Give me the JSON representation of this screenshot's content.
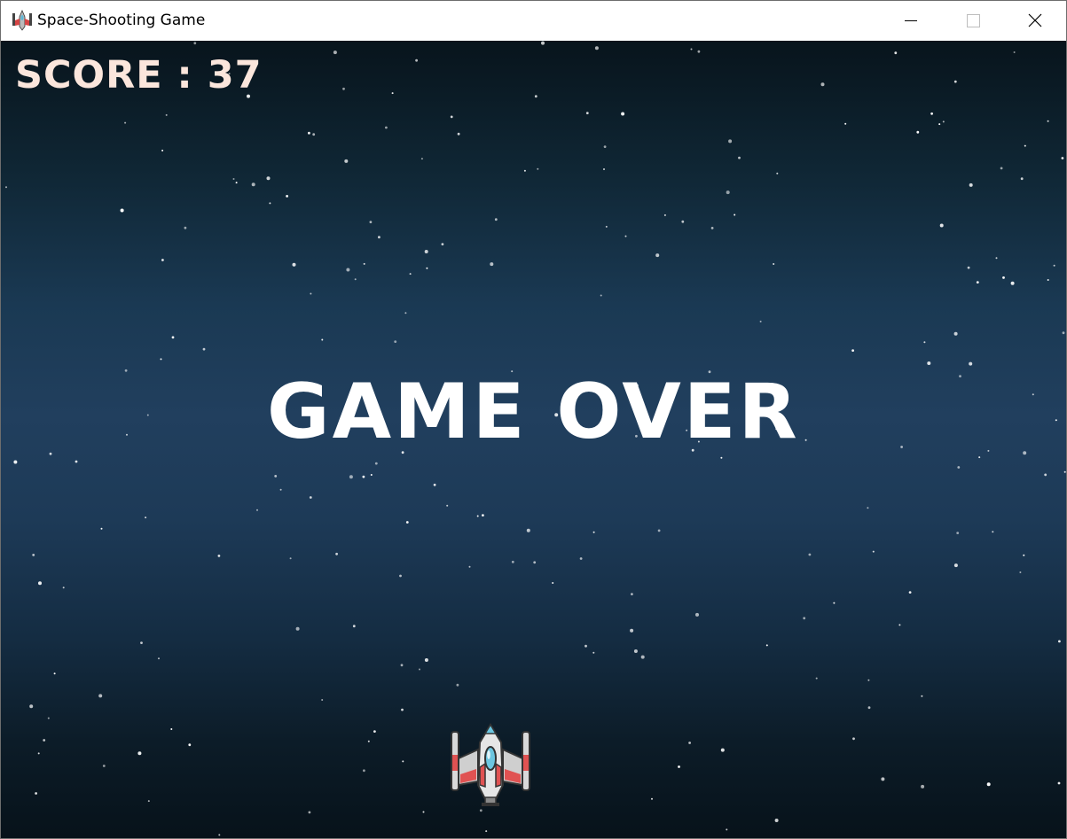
{
  "window": {
    "title": "Space-Shooting Game",
    "app_icon": "spaceship-icon",
    "controls": [
      "minimize-icon",
      "maximize-icon",
      "close-icon"
    ]
  },
  "hud": {
    "score_label": "SCORE",
    "score_separator": ":",
    "score_value": "37",
    "score_text": "SCORE : 37"
  },
  "overlay": {
    "message": "GAME OVER"
  },
  "player": {
    "sprite": "player-spaceship-icon"
  },
  "colors": {
    "score_text": "#fbe6dc",
    "game_over_text": "#ffffff",
    "space_dark": "#08141c",
    "space_mid": "#213f5e",
    "star": "#ffffff",
    "ship_body": "#d8d8d8",
    "ship_accent": "#e05252",
    "ship_cockpit": "#6cc6e0"
  }
}
